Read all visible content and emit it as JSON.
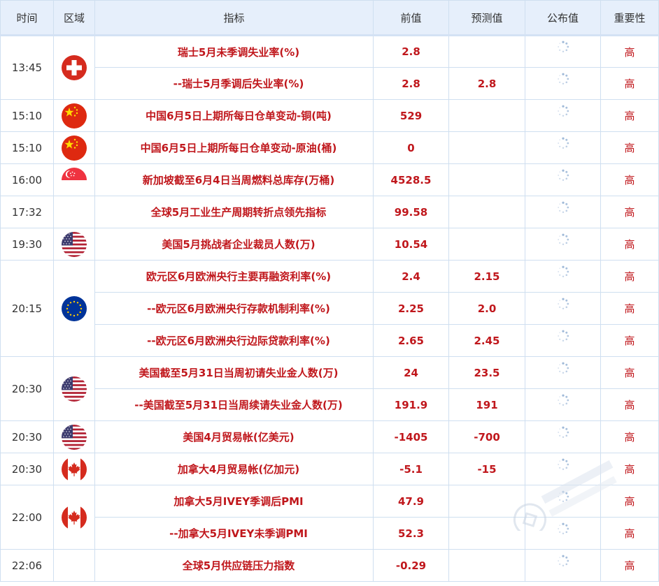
{
  "headers": [
    "时间",
    "区域",
    "指标",
    "前值",
    "预测值",
    "公布值",
    "重要性"
  ],
  "colors": {
    "accent": "#c0171c",
    "header_bg": "#e6effb",
    "border": "#cfdff0"
  },
  "rows": [
    {
      "time": "13:45",
      "indicator": "瑞士5月未季调失业率(%)",
      "prev": "2.8",
      "forecast": "",
      "importance": "高"
    },
    {
      "indicator": "--瑞士5月季调后失业率(%)",
      "prev": "2.8",
      "forecast": "2.8",
      "importance": "高"
    },
    {
      "time": "15:10",
      "indicator": "中国6月5日上期所每日仓单变动-铜(吨)",
      "prev": "529",
      "forecast": "",
      "importance": "高"
    },
    {
      "time": "15:10",
      "indicator": "中国6月5日上期所每日仓单变动-原油(桶)",
      "prev": "0",
      "forecast": "",
      "importance": "高"
    },
    {
      "time": "16:00",
      "indicator": "新加坡截至6月4日当周燃料总库存(万桶)",
      "prev": "4528.5",
      "forecast": "",
      "importance": "高"
    },
    {
      "time": "17:32",
      "indicator": "全球5月工业生产周期转折点领先指标",
      "prev": "99.58",
      "forecast": "",
      "importance": "高"
    },
    {
      "time": "19:30",
      "indicator": "美国5月挑战者企业裁员人数(万)",
      "prev": "10.54",
      "forecast": "",
      "importance": "高"
    },
    {
      "time": "20:15",
      "indicator": "欧元区6月欧洲央行主要再融资利率(%)",
      "prev": "2.4",
      "forecast": "2.15",
      "importance": "高"
    },
    {
      "indicator": "--欧元区6月欧洲央行存款机制利率(%)",
      "prev": "2.25",
      "forecast": "2.0",
      "importance": "高"
    },
    {
      "indicator": "--欧元区6月欧洲央行边际贷款利率(%)",
      "prev": "2.65",
      "forecast": "2.45",
      "importance": "高"
    },
    {
      "time": "20:30",
      "indicator": "美国截至5月31日当周初请失业金人数(万)",
      "prev": "24",
      "forecast": "23.5",
      "importance": "高"
    },
    {
      "indicator": "--美国截至5月31日当周续请失业金人数(万)",
      "prev": "191.9",
      "forecast": "191",
      "importance": "高"
    },
    {
      "time": "20:30",
      "indicator": "美国4月贸易帐(亿美元)",
      "prev": "-1405",
      "forecast": "-700",
      "importance": "高"
    },
    {
      "time": "20:30",
      "indicator": "加拿大4月贸易帐(亿加元)",
      "prev": "-5.1",
      "forecast": "-15",
      "importance": "高"
    },
    {
      "time": "22:00",
      "indicator": "加拿大5月IVEY季调后PMI",
      "prev": "47.9",
      "forecast": "",
      "importance": "高"
    },
    {
      "indicator": "--加拿大5月IVEY未季调PMI",
      "prev": "52.3",
      "forecast": "",
      "importance": "高"
    },
    {
      "time": "22:06",
      "indicator": "全球5月供应链压力指数",
      "prev": "-0.29",
      "forecast": "",
      "importance": "高"
    }
  ],
  "flags": {
    "r0": "switzerland-flag-icon",
    "r2": "china-flag-icon",
    "r3": "china-flag-icon",
    "r4": "singapore-flag-icon",
    "r6": "usa-flag-icon",
    "r7": "eu-flag-icon",
    "r10": "usa-flag-icon",
    "r12": "usa-flag-icon",
    "r13": "canada-flag-icon",
    "r14": "canada-flag-icon"
  },
  "watermark_icon": "fx678-watermark-icon"
}
